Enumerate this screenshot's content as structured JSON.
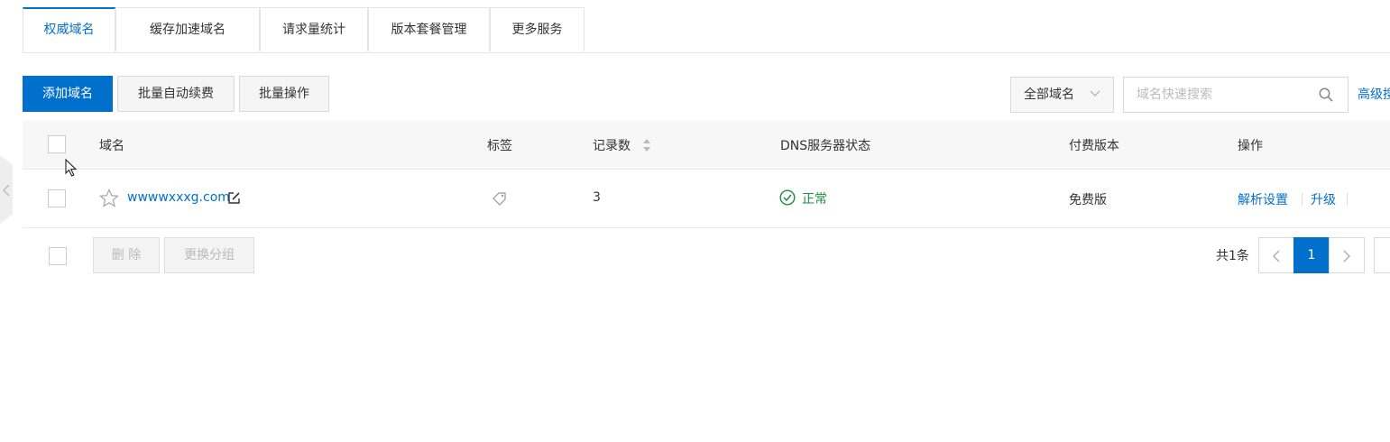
{
  "tabs": [
    {
      "label": "权威域名",
      "active": true
    },
    {
      "label": "缓存加速域名",
      "active": false
    },
    {
      "label": "请求量统计",
      "active": false
    },
    {
      "label": "版本套餐管理",
      "active": false
    },
    {
      "label": "更多服务",
      "active": false
    }
  ],
  "toolbar": {
    "add_domain": "添加域名",
    "batch_renew": "批量自动续费",
    "batch_ops": "批量操作",
    "filter_selected": "全部域名",
    "search_placeholder": "域名快速搜索",
    "advanced_search": "高级搜索"
  },
  "table": {
    "headers": {
      "domain": "域名",
      "tag": "标签",
      "records": "记录数",
      "dns_status": "DNS服务器状态",
      "edition": "付费版本",
      "actions": "操作"
    },
    "rows": [
      {
        "domain": "wwwwxxxg.com",
        "records": "3",
        "dns_status": "正常",
        "edition": "免费版",
        "action_resolve": "解析设置",
        "action_upgrade": "升级"
      }
    ]
  },
  "footer": {
    "delete": "删 除",
    "change_group": "更换分组",
    "total": "共1条",
    "current_page": "1"
  },
  "colors": {
    "accent": "#0070cc",
    "success": "#1e8e3e"
  },
  "icons": {
    "star": "star-icon",
    "edit": "edit-icon",
    "tag": "tag-icon",
    "sort": "sort-icon",
    "check_circle": "check-circle-icon",
    "search": "search-icon",
    "chevron_down": "chevron-down-icon"
  }
}
